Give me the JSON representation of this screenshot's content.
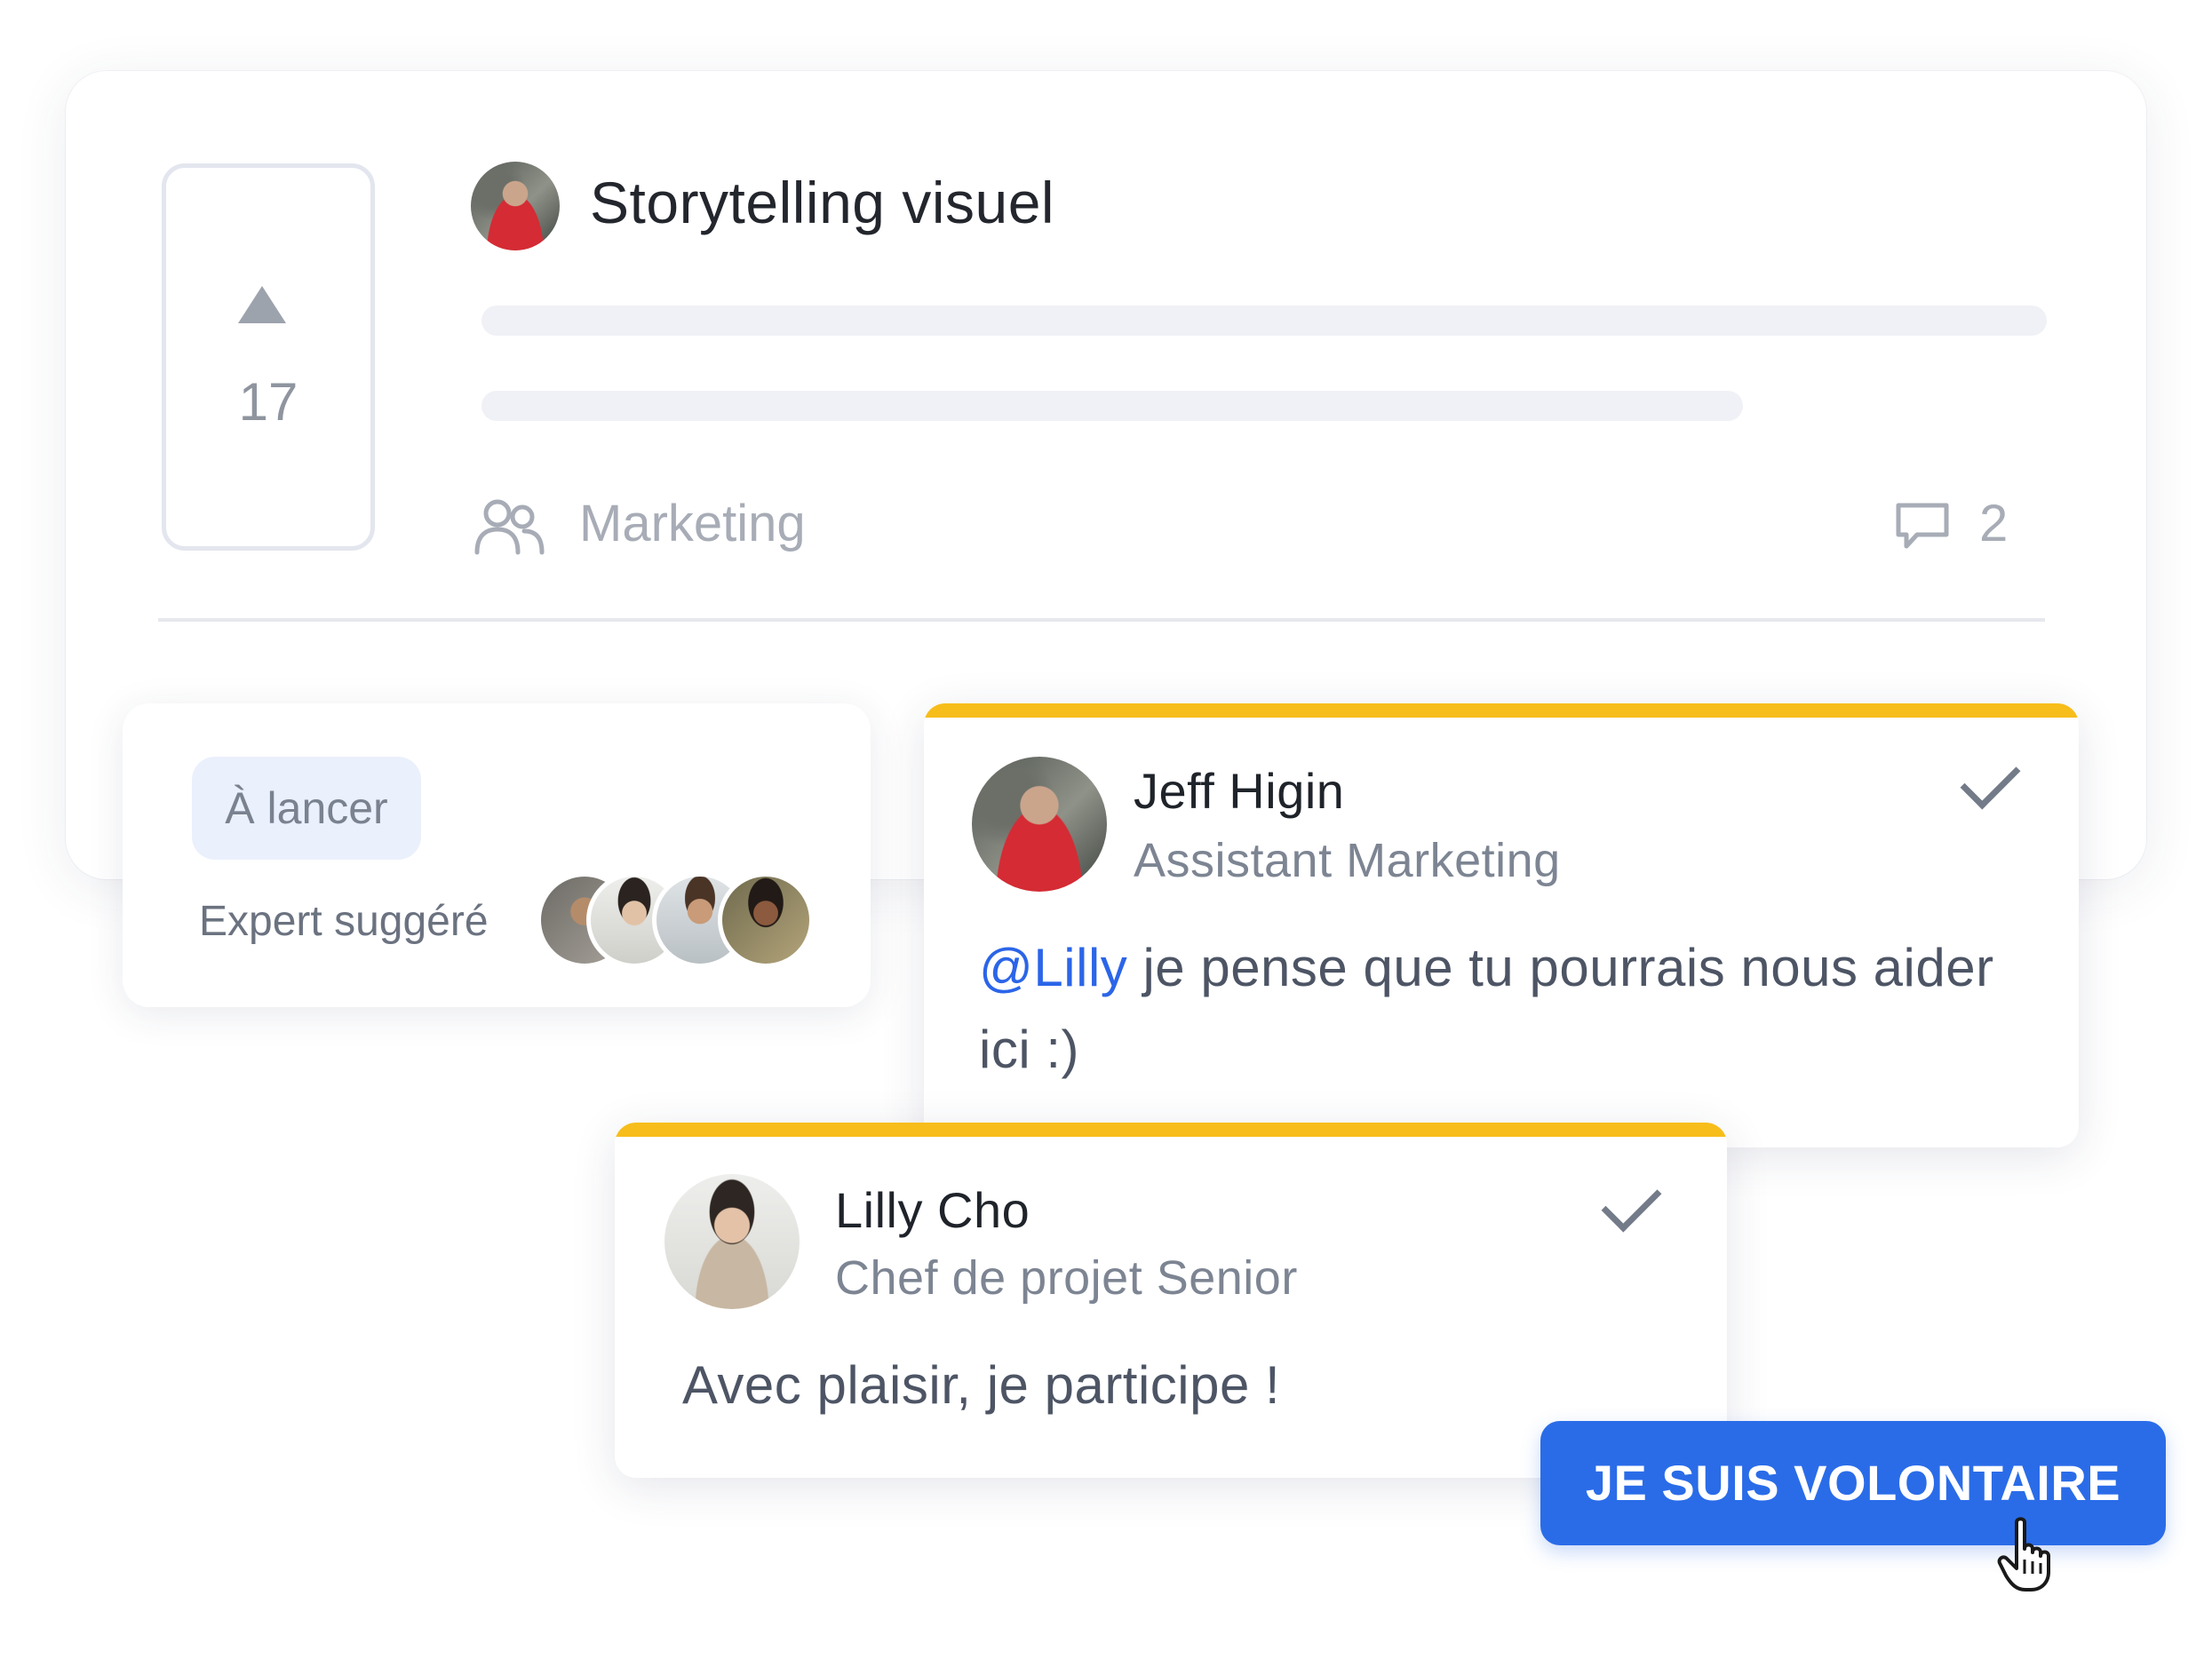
{
  "idea": {
    "title": "Storytelling visuel",
    "votes": "17",
    "team": "Marketing",
    "comment_count": "2",
    "icons": {
      "vote": "upvote-triangle-icon",
      "team": "team-icon",
      "comments": "comment-bubble-icon"
    }
  },
  "status": {
    "badge": "À lancer",
    "expert_label": "Expert suggéré"
  },
  "comments": [
    {
      "name": "Jeff Higin",
      "role": "Assistant Marketing",
      "mention": "@Lilly",
      "text": " je pense que tu pourrais nous aider ici :)"
    },
    {
      "name": "Lilly Cho",
      "role": "Chef de projet Senior",
      "text": "Avec plaisir, je participe !"
    }
  ],
  "cta": {
    "label": "JE SUIS VOLONTAIRE"
  },
  "colors": {
    "accent": "#2a6ce8",
    "highlight_bar": "#f7bd1b",
    "mention": "#2b65e8",
    "badge_bg": "#eaf0fc"
  }
}
